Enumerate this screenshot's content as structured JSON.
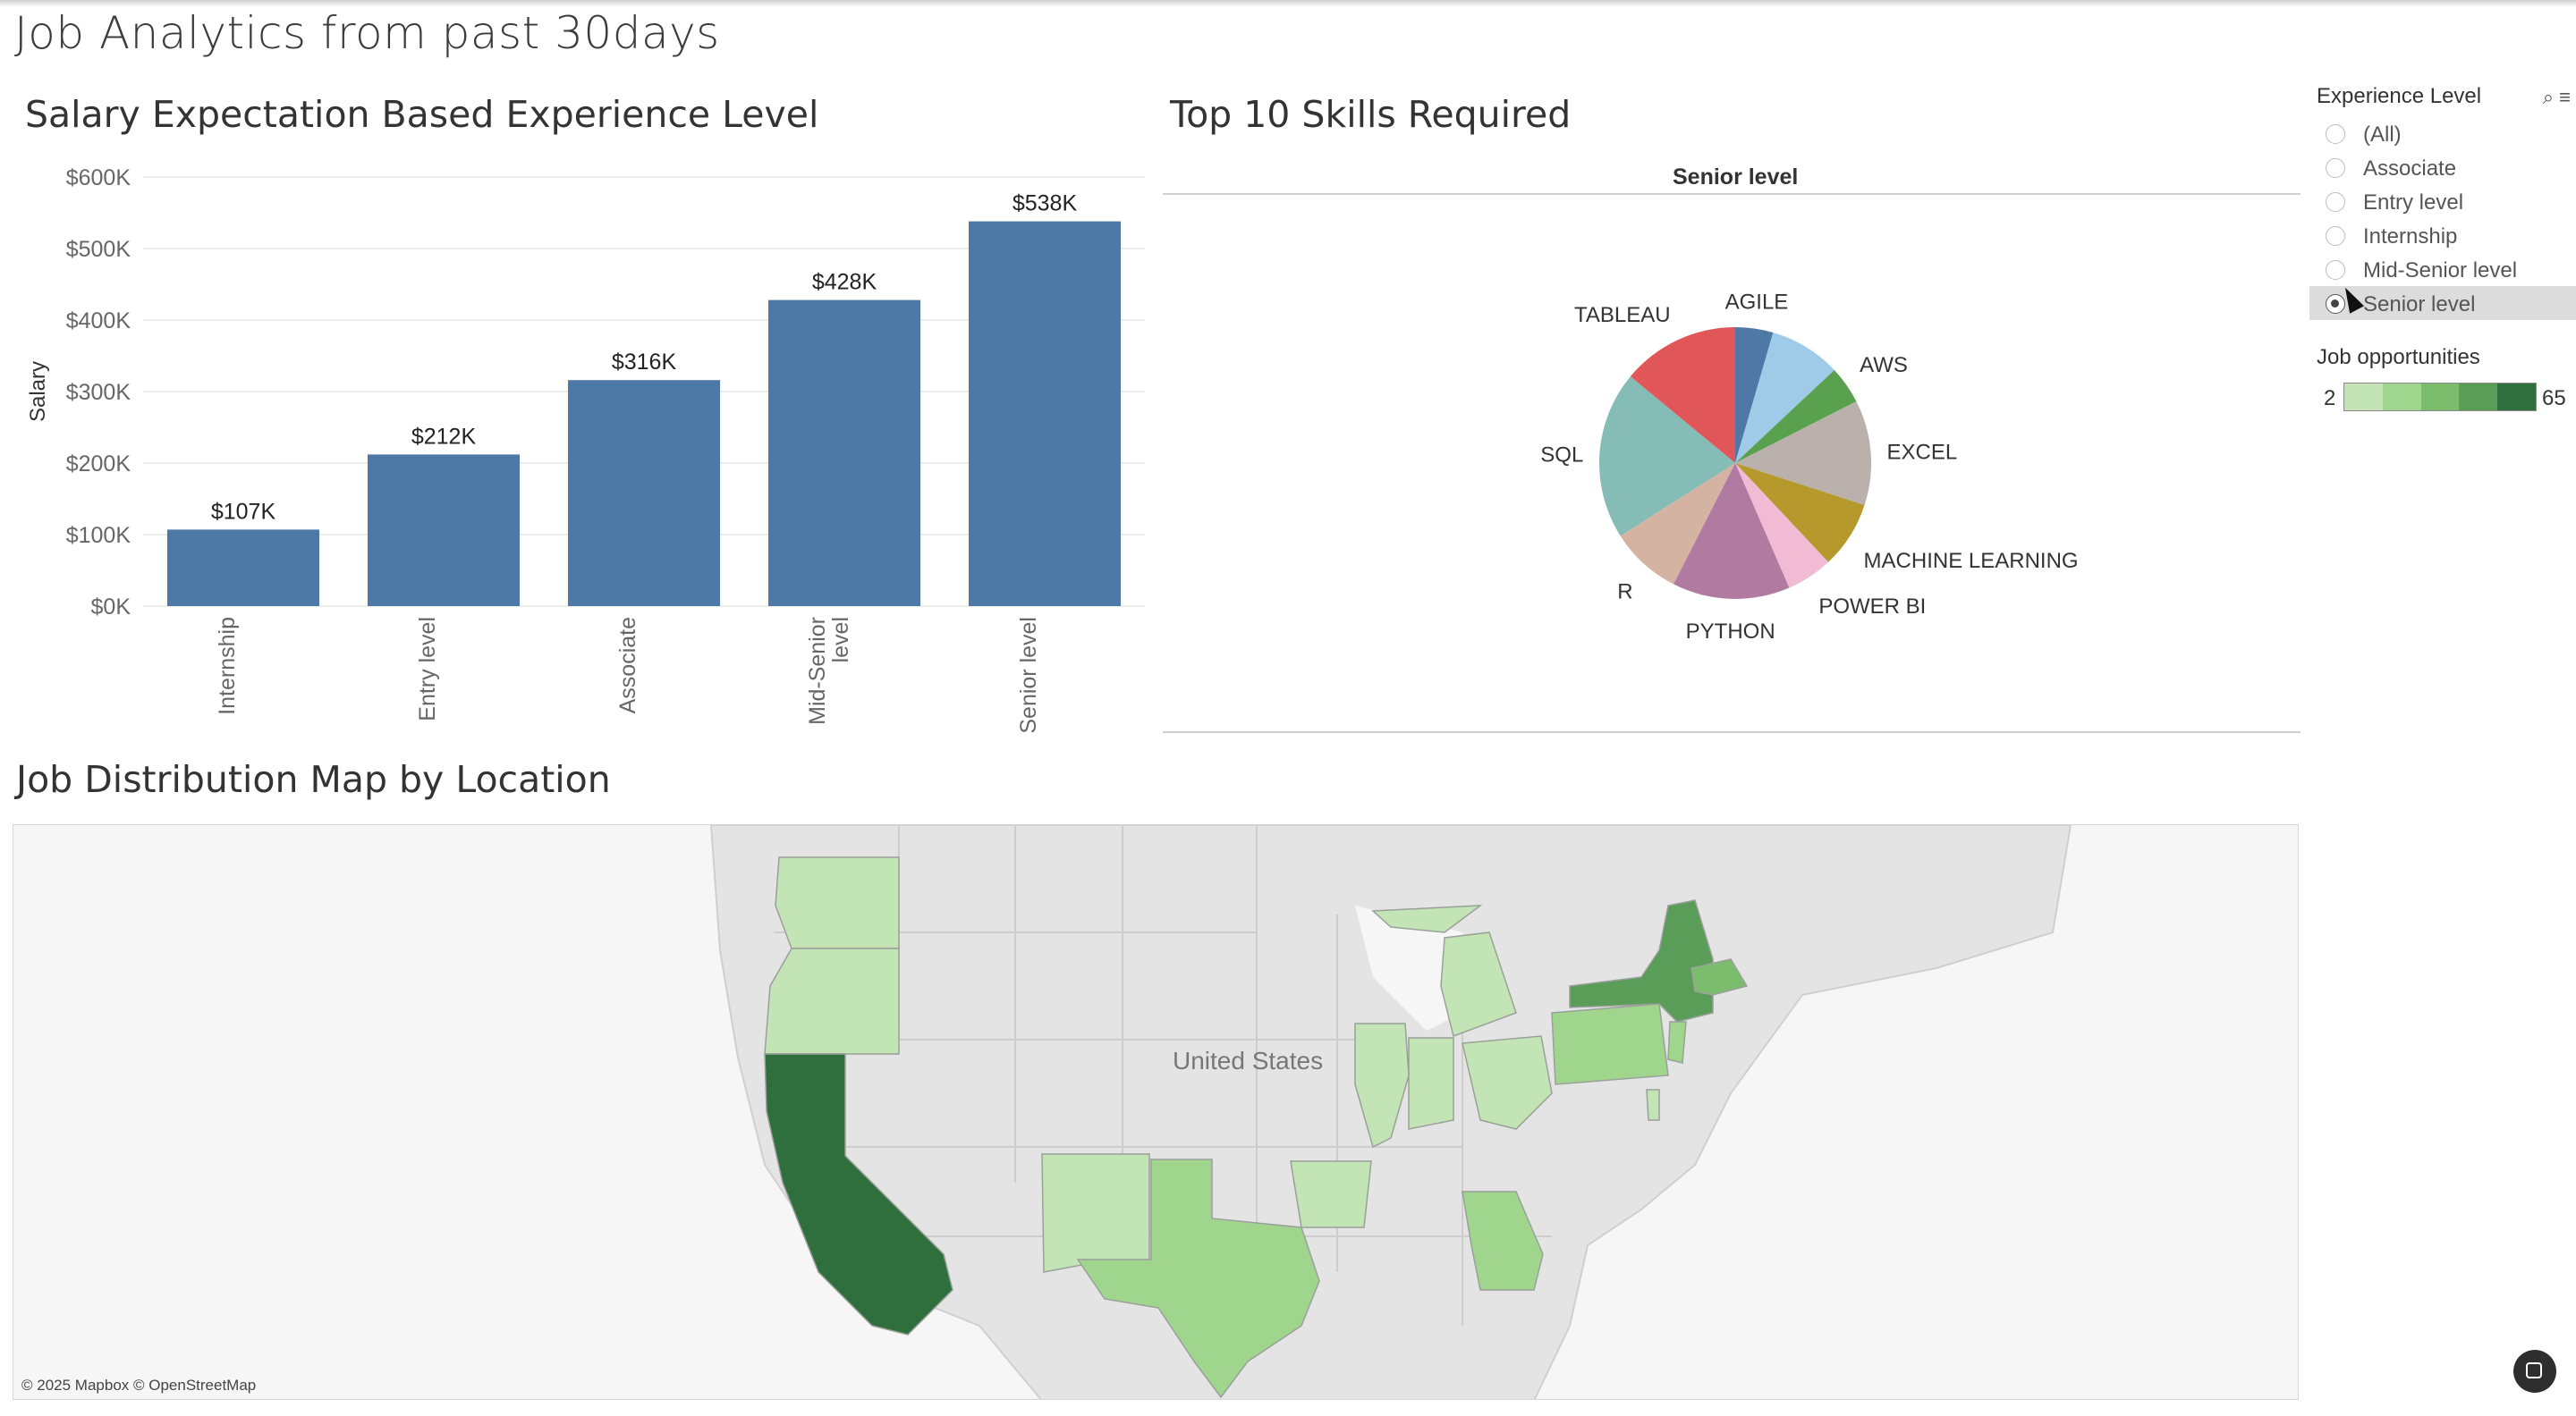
{
  "dashboard": {
    "title": "Job Analytics from past 30days"
  },
  "bar_section": {
    "title": "Salary Expectation Based Experience Level"
  },
  "pie_section": {
    "title": "Top 10 Skills Required",
    "subtitle": "Senior level"
  },
  "map_section": {
    "title": "Job Distribution Map by Location",
    "country_label": "United States",
    "attribution": "© 2025 Mapbox © OpenStreetMap"
  },
  "filter": {
    "title": "Experience Level",
    "options": [
      {
        "label": "(All)",
        "selected": false
      },
      {
        "label": "Associate",
        "selected": false
      },
      {
        "label": "Entry level",
        "selected": false
      },
      {
        "label": "Internship",
        "selected": false
      },
      {
        "label": "Mid-Senior level",
        "selected": false
      },
      {
        "label": "Senior level",
        "selected": true
      }
    ]
  },
  "legend": {
    "title": "Job opportunities",
    "min": "2",
    "max": "65",
    "colors": [
      "#c3e4b5",
      "#9fd58c",
      "#7bbd6c",
      "#5a9d58",
      "#2f6f3e"
    ]
  },
  "chart_data": [
    {
      "type": "bar",
      "ylabel": "Salary",
      "categories": [
        "Internship",
        "Entry level",
        "Associate",
        "Mid-Senior level",
        "Senior level"
      ],
      "category_lines": [
        [
          "Internship"
        ],
        [
          "Entry level"
        ],
        [
          "Associate"
        ],
        [
          "Mid-Senior",
          "level"
        ],
        [
          "Senior level"
        ]
      ],
      "values": [
        107,
        212,
        316,
        428,
        538
      ],
      "value_labels": [
        "$107K",
        "$212K",
        "$316K",
        "$428K",
        "$538K"
      ],
      "ylim": [
        0,
        600
      ],
      "yticks": [
        0,
        100,
        200,
        300,
        400,
        500,
        600
      ],
      "ytick_labels": [
        "$0K",
        "$100K",
        "$200K",
        "$300K",
        "$400K",
        "$500K",
        "$600K"
      ],
      "color": "#4e79a7",
      "grid": true
    },
    {
      "type": "pie",
      "title": "Senior level",
      "slices": [
        {
          "label": "AGILE",
          "value": 4.5,
          "color": "#4e79a7"
        },
        {
          "label": "",
          "value": 8.5,
          "color": "#a0cbe8"
        },
        {
          "label": "AWS",
          "value": 4.5,
          "color": "#59a14f"
        },
        {
          "label": "EXCEL",
          "value": 12.5,
          "color": "#bab0ac"
        },
        {
          "label": "MACHINE LEARNING",
          "value": 8,
          "color": "#b6992d"
        },
        {
          "label": "POWER BI",
          "value": 5.5,
          "color": "#f1bbd3"
        },
        {
          "label": "PYTHON",
          "value": 14,
          "color": "#b07aa1"
        },
        {
          "label": "R",
          "value": 8.5,
          "color": "#d4b3a3"
        },
        {
          "label": "SQL",
          "value": 20,
          "color": "#86bcb6"
        },
        {
          "label": "TABLEAU",
          "value": 14,
          "color": "#e15759"
        }
      ]
    }
  ],
  "map_states": [
    {
      "name": "washington",
      "level": 0
    },
    {
      "name": "oregon",
      "level": 0
    },
    {
      "name": "california",
      "level": 4
    },
    {
      "name": "new-mexico",
      "level": 0
    },
    {
      "name": "texas",
      "level": 1
    },
    {
      "name": "arkansas",
      "level": 0
    },
    {
      "name": "illinois",
      "level": 0
    },
    {
      "name": "indiana",
      "level": 0
    },
    {
      "name": "michigan",
      "level": 0
    },
    {
      "name": "ohio",
      "level": 0
    },
    {
      "name": "georgia",
      "level": 1
    },
    {
      "name": "pennsylvania",
      "level": 1
    },
    {
      "name": "new-york",
      "level": 3
    },
    {
      "name": "massachusetts",
      "level": 2
    },
    {
      "name": "new-jersey",
      "level": 1
    },
    {
      "name": "delaware",
      "level": 0
    }
  ]
}
